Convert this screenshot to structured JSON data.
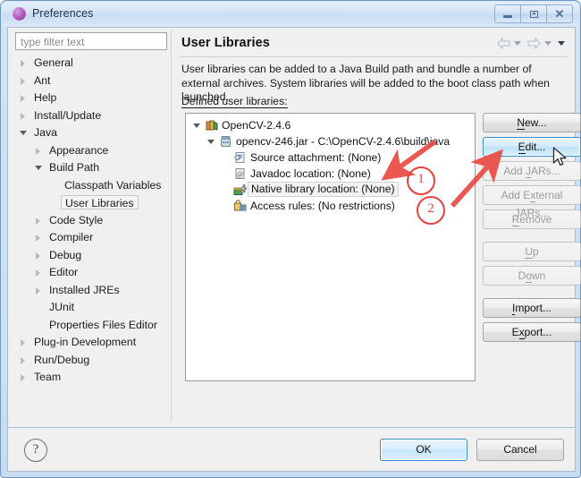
{
  "window": {
    "title": "Preferences",
    "icon": "preferences-orb-icon",
    "controls": {
      "minimize": "minimize-icon",
      "maximize": "maximize-icon",
      "close": "close-icon"
    }
  },
  "sidebar": {
    "filter": {
      "placeholder": "type filter text",
      "value": ""
    },
    "items": [
      {
        "label": "General",
        "indent": 0,
        "state": "collapsed"
      },
      {
        "label": "Ant",
        "indent": 0,
        "state": "collapsed"
      },
      {
        "label": "Help",
        "indent": 0,
        "state": "collapsed"
      },
      {
        "label": "Install/Update",
        "indent": 0,
        "state": "collapsed"
      },
      {
        "label": "Java",
        "indent": 0,
        "state": "expanded"
      },
      {
        "label": "Appearance",
        "indent": 1,
        "state": "collapsed"
      },
      {
        "label": "Build Path",
        "indent": 1,
        "state": "expanded"
      },
      {
        "label": "Classpath Variables",
        "indent": 2,
        "state": "leaf"
      },
      {
        "label": "User Libraries",
        "indent": 2,
        "state": "leaf",
        "selected": true
      },
      {
        "label": "Code Style",
        "indent": 1,
        "state": "collapsed"
      },
      {
        "label": "Compiler",
        "indent": 1,
        "state": "collapsed"
      },
      {
        "label": "Debug",
        "indent": 1,
        "state": "collapsed"
      },
      {
        "label": "Editor",
        "indent": 1,
        "state": "collapsed"
      },
      {
        "label": "Installed JREs",
        "indent": 1,
        "state": "collapsed"
      },
      {
        "label": "JUnit",
        "indent": 1,
        "state": "leaf"
      },
      {
        "label": "Properties Files Editor",
        "indent": 1,
        "state": "leaf"
      },
      {
        "label": "Plug-in Development",
        "indent": 0,
        "state": "collapsed"
      },
      {
        "label": "Run/Debug",
        "indent": 0,
        "state": "collapsed"
      },
      {
        "label": "Team",
        "indent": 0,
        "state": "collapsed"
      }
    ]
  },
  "page": {
    "title": "User Libraries",
    "description": "User libraries can be added to a Java Build path and bundle a number of external archives. System libraries will be added to the boot class path when launched.",
    "list_label": "Defined user libraries:",
    "nav": {
      "back": "back-arrow-icon",
      "back_menu": "back-dropdown-icon",
      "forward": "forward-arrow-icon",
      "forward_menu": "forward-dropdown-icon",
      "view_menu": "view-menu-icon"
    }
  },
  "tree": {
    "nodes": [
      {
        "label": "OpenCV-2.4.6",
        "indent": 0,
        "state": "expanded",
        "icon": "user-library-icon"
      },
      {
        "label": "opencv-246.jar - C:\\OpenCV-2.4.6\\build\\java",
        "indent": 1,
        "state": "expanded",
        "icon": "jar-icon"
      },
      {
        "label": "Source attachment: (None)",
        "indent": 2,
        "state": "leaf",
        "icon": "source-attachment-icon"
      },
      {
        "label": "Javadoc location: (None)",
        "indent": 2,
        "state": "leaf",
        "icon": "javadoc-icon"
      },
      {
        "label": "Native library location: (None)",
        "indent": 2,
        "state": "leaf",
        "icon": "native-library-icon",
        "selected": true
      },
      {
        "label": "Access rules: (No restrictions)",
        "indent": 2,
        "state": "leaf",
        "icon": "access-rules-icon"
      }
    ]
  },
  "buttons": [
    {
      "label": "New...",
      "mnemonic": "N",
      "enabled": true,
      "focused": false,
      "name": "new-button"
    },
    {
      "label": "Edit...",
      "mnemonic": "E",
      "enabled": true,
      "focused": true,
      "name": "edit-button"
    },
    {
      "label": "Add JARs...",
      "mnemonic": "J",
      "enabled": false,
      "focused": false,
      "name": "add-jars-button"
    },
    {
      "label": "Add External JARs...",
      "mnemonic": "x",
      "enabled": false,
      "focused": false,
      "name": "add-external-jars-button"
    },
    {
      "label": "Remove",
      "mnemonic": "R",
      "enabled": false,
      "focused": false,
      "name": "remove-button"
    },
    {
      "label": "Up",
      "mnemonic": "U",
      "enabled": false,
      "focused": false,
      "name": "up-button",
      "spacer_before": true
    },
    {
      "label": "Down",
      "mnemonic": "o",
      "enabled": false,
      "focused": false,
      "name": "down-button"
    },
    {
      "label": "Import...",
      "mnemonic": "I",
      "enabled": true,
      "focused": false,
      "name": "import-button",
      "spacer_before": true
    },
    {
      "label": "Export...",
      "mnemonic": "x",
      "enabled": true,
      "focused": false,
      "name": "export-button"
    }
  ],
  "footer": {
    "help": "?",
    "ok": "OK",
    "cancel": "Cancel"
  },
  "annotations": {
    "color": "#e8403a",
    "marker_one": "1",
    "marker_two": "2"
  }
}
